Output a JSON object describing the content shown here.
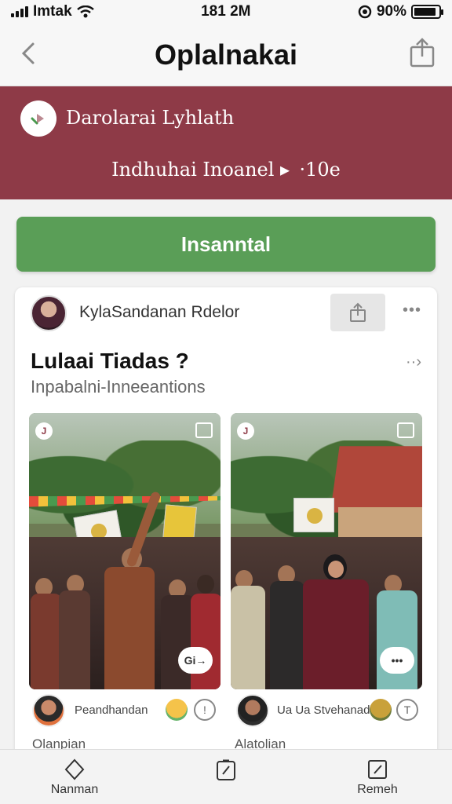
{
  "status_bar": {
    "carrier": "Imtak",
    "time": "181 2M",
    "battery": "90%",
    "battery_level": 0.9
  },
  "nav": {
    "title": "Oplalnakai"
  },
  "banner": {
    "title": "Darolarai Lyhlath",
    "subtitle": "Indhuhai Inoanel ▸  ·10e"
  },
  "cta": {
    "label": "Insanntal"
  },
  "post": {
    "author": "KylaSandanan Rdelor",
    "title": "Lulaai Tiadas ?",
    "subtitle": "Inpabalni-Inneeantions",
    "left_caption": "Peandhandan",
    "right_caption": "Ua Ua Stvehanad",
    "left_footer": "Olanpian",
    "right_footer": "Alatolian",
    "left_pill": "Gi→",
    "right_pill": "•••"
  },
  "tabs": [
    {
      "label": "Nanman"
    },
    {
      "label": ""
    },
    {
      "label": "Remeh"
    }
  ],
  "colors": {
    "banner": "#8e3a47",
    "cta": "#5a9e57"
  }
}
